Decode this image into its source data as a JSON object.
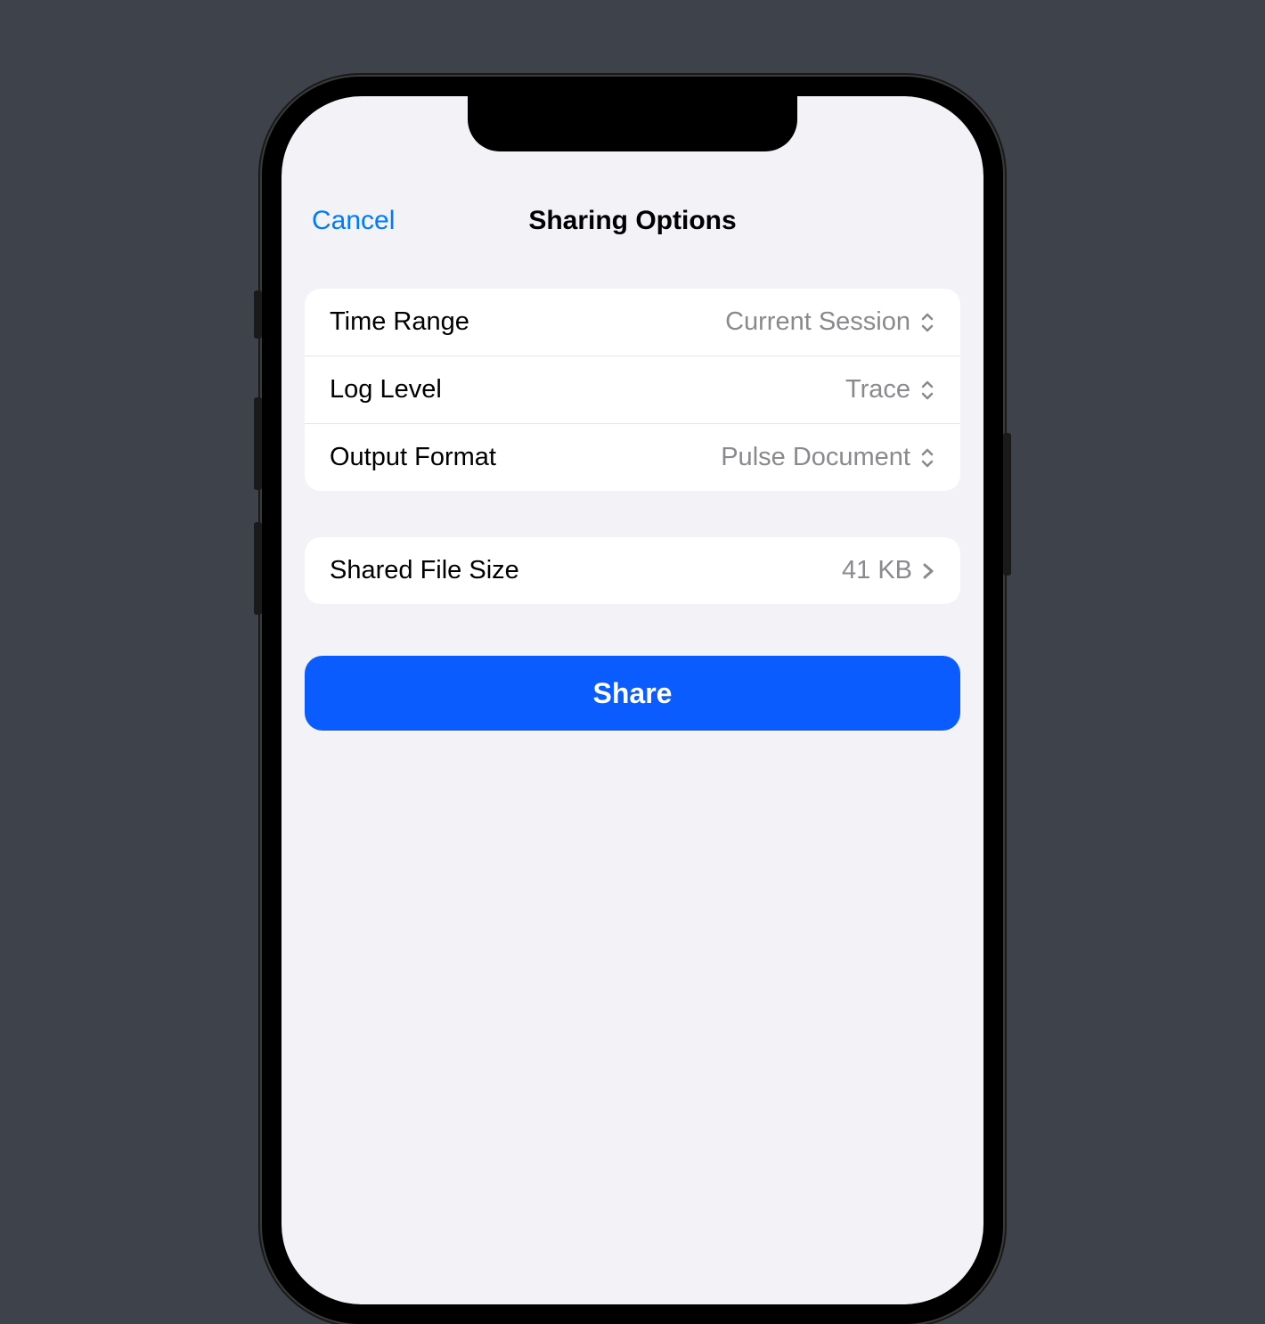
{
  "nav": {
    "cancel_label": "Cancel",
    "title": "Sharing Options"
  },
  "options": {
    "time_range": {
      "label": "Time Range",
      "value": "Current Session"
    },
    "log_level": {
      "label": "Log Level",
      "value": "Trace"
    },
    "output_format": {
      "label": "Output Format",
      "value": "Pulse Document"
    }
  },
  "file": {
    "label": "Shared File Size",
    "size": "41 KB"
  },
  "actions": {
    "share_label": "Share"
  },
  "colors": {
    "accent": "#007aff",
    "primary_button": "#0a5cff",
    "secondary_text": "#8a8a8e",
    "background": "#f2f2f7"
  }
}
